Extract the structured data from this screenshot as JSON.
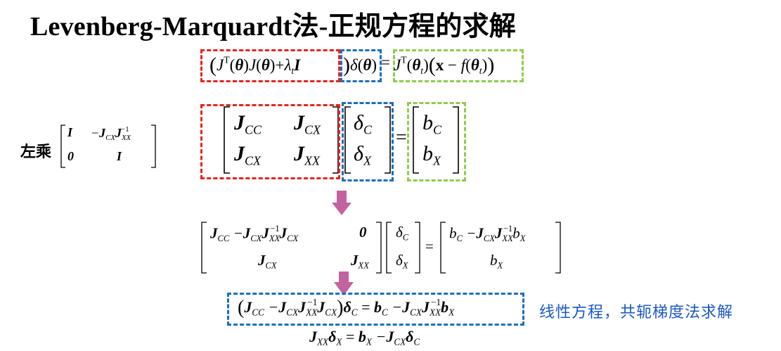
{
  "title": "Levenberg-Marquardt法-正规方程的求解",
  "left_label": "左乘",
  "right_label": "线性方程，共轭梯度法求解",
  "colors": {
    "red_box": "#e8231c",
    "blue_box": "#1b6fbd",
    "green_box": "#8fcd4b",
    "arrow": "#c2639f",
    "annotation_text": "#1a58c2"
  },
  "eq1": {
    "lhs_matrix": "(Jᵀ(θ)J(θ)+λₜI)",
    "delta": "δ(θ)",
    "equals": "=",
    "rhs": "Jᵀ(θₜ)(x − f(θₜ))"
  },
  "left_multiplier": {
    "r1c1": "I",
    "r1c2": "−J_CX J_XX^−1",
    "r2c1": "0",
    "r2c2": "I"
  },
  "block_system": {
    "a11": "J_CC",
    "a12": "J_CX",
    "a21": "J_CX",
    "a22": "J_XX",
    "d1": "δ_C",
    "d2": "δ_X",
    "b1": "b_C",
    "b2": "b_X",
    "equals": "="
  },
  "transformed_system": {
    "a11": "J_CC − J_CX J_XX^−1 J_CX",
    "a12": "0",
    "a21": "J_CX",
    "a22": "J_XX",
    "d1": "δ_C",
    "d2": "δ_X",
    "b1": "b_C − J_CX J_XX^−1 b_X",
    "b2": "b_X",
    "equals": "="
  },
  "schur_eq": "(J_CC − J_CX J_XX^−1 J_CX) δ_C = b_C − J_CX J_XX^−1 b_X",
  "back_sub_eq": "J_XX δ_X = b_X − J_CX δ_C"
}
